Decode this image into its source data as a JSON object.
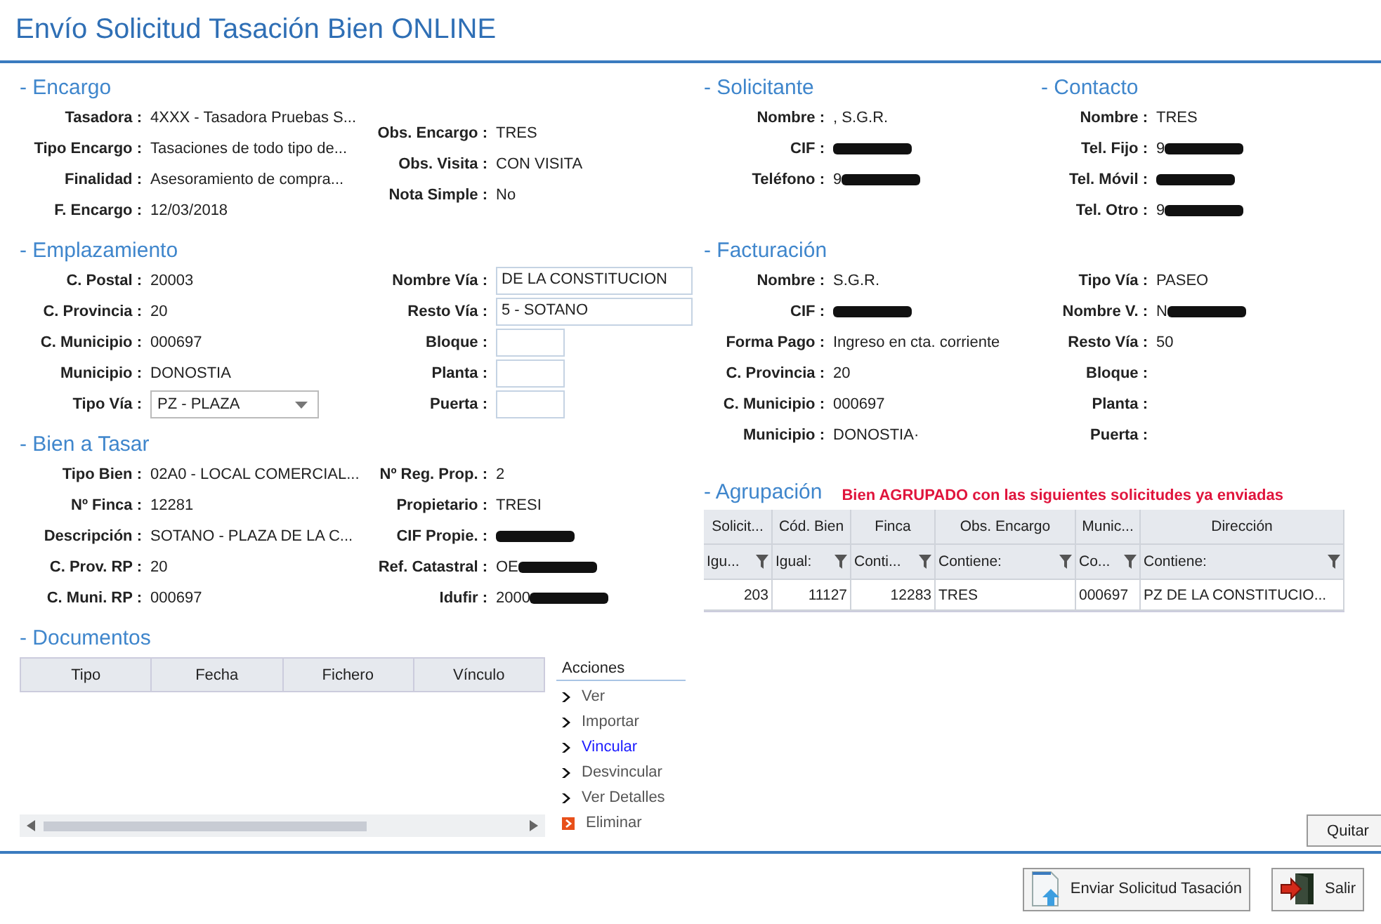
{
  "window": {
    "title": "Envío Solicitud Tasación Bien ONLINE"
  },
  "encargo": {
    "title": "- Encargo",
    "left": [
      {
        "label": "Tasadora :",
        "value": "4XXX - Tasadora Pruebas S..."
      },
      {
        "label": "Tipo Encargo :",
        "value": "Tasaciones de todo tipo de..."
      },
      {
        "label": "Finalidad :",
        "value": "Asesoramiento de compra..."
      },
      {
        "label": "F. Encargo :",
        "value": "12/03/2018"
      }
    ],
    "right": [
      {
        "label": "Obs. Encargo :",
        "value": "TRES"
      },
      {
        "label": "Obs. Visita :",
        "value": "CON VISITA"
      },
      {
        "label": "Nota Simple :",
        "value": "No"
      }
    ]
  },
  "emplazamiento": {
    "title": "- Emplazamiento",
    "left": [
      {
        "label": "C. Postal :",
        "value": "20003",
        "kind": "text"
      },
      {
        "label": "C. Provincia :",
        "value": "20",
        "kind": "text"
      },
      {
        "label": "C. Municipio :",
        "value": "000697",
        "kind": "text"
      },
      {
        "label": "Municipio :",
        "value": "DONOSTIA",
        "kind": "text"
      },
      {
        "label": "Tipo Vía :",
        "value": "PZ - PLAZA",
        "kind": "select"
      }
    ],
    "right": [
      {
        "label": "Nombre Vía :",
        "value": "DE LA CONSTITUCION",
        "kind": "input"
      },
      {
        "label": "Resto Vía :",
        "value": "5 - SOTANO",
        "kind": "input"
      },
      {
        "label": "Bloque :",
        "kind": "small-input"
      },
      {
        "label": "Planta :",
        "kind": "small-input"
      },
      {
        "label": "Puerta :",
        "kind": "small-input"
      }
    ]
  },
  "bien": {
    "title": "- Bien a Tasar",
    "left": [
      {
        "label": "Tipo Bien :",
        "value": "02A0 - LOCAL COMERCIAL..."
      },
      {
        "label": "Nº Finca :",
        "value": "12281"
      },
      {
        "label": "Descripción :",
        "value": "SOTANO - PLAZA DE LA C..."
      },
      {
        "label": "C. Prov. RP :",
        "value": "20"
      },
      {
        "label": "C. Muni. RP :",
        "value": "000697"
      }
    ],
    "right": [
      {
        "label": "Nº Reg. Prop. :",
        "value": "2"
      },
      {
        "label": "Propietario :",
        "value": "TRESI"
      },
      {
        "label": "CIF Propie. :",
        "redacted": true
      },
      {
        "label": "Ref. Catastral :",
        "value": "OE",
        "redacted": true
      },
      {
        "label": "Idufir :",
        "value": "2000",
        "redacted": true
      }
    ]
  },
  "documentos": {
    "title": "- Documentos",
    "columns": [
      "Tipo",
      "Fecha",
      "Fichero",
      "Vínculo"
    ],
    "actions_title": "Acciones",
    "actions": [
      {
        "label": "Ver",
        "kind": "action",
        "highlighted": false
      },
      {
        "label": "Importar",
        "kind": "action",
        "highlighted": false
      },
      {
        "label": "Vincular",
        "kind": "action",
        "highlighted": true
      },
      {
        "label": "Desvincular",
        "kind": "action",
        "highlighted": false
      },
      {
        "label": "Ver Detalles",
        "kind": "action",
        "highlighted": false
      },
      {
        "label": "Eliminar",
        "kind": "delete",
        "highlighted": false
      }
    ]
  },
  "solicitante": {
    "title": "- Solicitante",
    "fields": [
      {
        "label": "Nombre :",
        "value": ", S.G.R."
      },
      {
        "label": "CIF :",
        "redacted": true
      },
      {
        "label": "Teléfono :",
        "value": "9",
        "redacted": true
      }
    ]
  },
  "contacto": {
    "title": "- Contacto",
    "fields": [
      {
        "label": "Nombre :",
        "value": "TRES"
      },
      {
        "label": "Tel. Fijo :",
        "value": "9",
        "redacted": true
      },
      {
        "label": "Tel. Móvil :",
        "redacted": true
      },
      {
        "label": "Tel. Otro :",
        "value": "9",
        "redacted": true
      }
    ]
  },
  "facturacion": {
    "title": "- Facturación",
    "left": [
      {
        "label": "Nombre :",
        "value": "S.G.R."
      },
      {
        "label": "CIF :",
        "redacted": true
      },
      {
        "label": "Forma Pago :",
        "value": "Ingreso en cta. corriente"
      },
      {
        "label": "C. Provincia :",
        "value": "20"
      },
      {
        "label": "C. Municipio :",
        "value": "000697"
      },
      {
        "label": "Municipio :",
        "value": "DONOSTIA·"
      }
    ],
    "right": [
      {
        "label": "Tipo Vía :",
        "value": "PASEO"
      },
      {
        "label": "Nombre V. :",
        "value": "N",
        "redacted": true
      },
      {
        "label": "Resto Vía :",
        "value": "50"
      },
      {
        "label": "Bloque :"
      },
      {
        "label": "Planta :"
      },
      {
        "label": "Puerta :"
      }
    ]
  },
  "agrupacion": {
    "title": "- Agrupación",
    "note": "Bien AGRUPADO con las siguientes solicitudes ya enviadas",
    "columns": [
      {
        "header": "Solicit...",
        "filter": "Igu...",
        "numeric": true
      },
      {
        "header": "Cód. Bien",
        "filter": "Igual:",
        "numeric": true
      },
      {
        "header": "Finca",
        "filter": "Conti...",
        "numeric": true
      },
      {
        "header": "Obs. Encargo",
        "filter": "Contiene:",
        "numeric": false
      },
      {
        "header": "Munic...",
        "filter": "Co...",
        "numeric": false
      },
      {
        "header": "Dirección",
        "filter": "Contiene:",
        "numeric": false
      }
    ],
    "rows": [
      [
        "203",
        "11127",
        "12283",
        "TRES",
        "000697",
        "PZ DE LA CONSTITUCIO..."
      ]
    ],
    "remove_button": "Quitar"
  },
  "footer": {
    "buttons": [
      {
        "label": "Enviar Solicitud Tasación",
        "kind": "send"
      },
      {
        "label": "Salir",
        "kind": "exit"
      }
    ]
  }
}
